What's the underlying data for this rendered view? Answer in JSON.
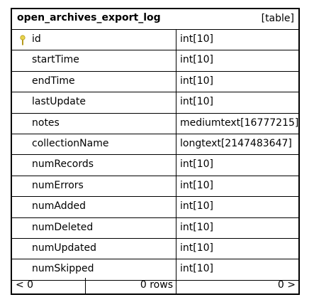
{
  "table": {
    "name": "open_archives_export_log",
    "kind": "[table]",
    "columns": [
      {
        "name": "id",
        "type": "int[10]",
        "primary_key": true
      },
      {
        "name": "startTime",
        "type": "int[10]"
      },
      {
        "name": "endTime",
        "type": "int[10]"
      },
      {
        "name": "lastUpdate",
        "type": "int[10]"
      },
      {
        "name": "notes",
        "type": "mediumtext[16777215]"
      },
      {
        "name": "collectionName",
        "type": "longtext[2147483647]"
      },
      {
        "name": "numRecords",
        "type": "int[10]"
      },
      {
        "name": "numErrors",
        "type": "int[10]"
      },
      {
        "name": "numAdded",
        "type": "int[10]"
      },
      {
        "name": "numDeleted",
        "type": "int[10]"
      },
      {
        "name": "numUpdated",
        "type": "int[10]"
      },
      {
        "name": "numSkipped",
        "type": "int[10]"
      }
    ]
  },
  "footer": {
    "prev": "< 0",
    "rows": "0 rows",
    "next": "0 >"
  },
  "icons": {
    "primary_key": "key-icon",
    "key_color": "#e8d44d"
  }
}
